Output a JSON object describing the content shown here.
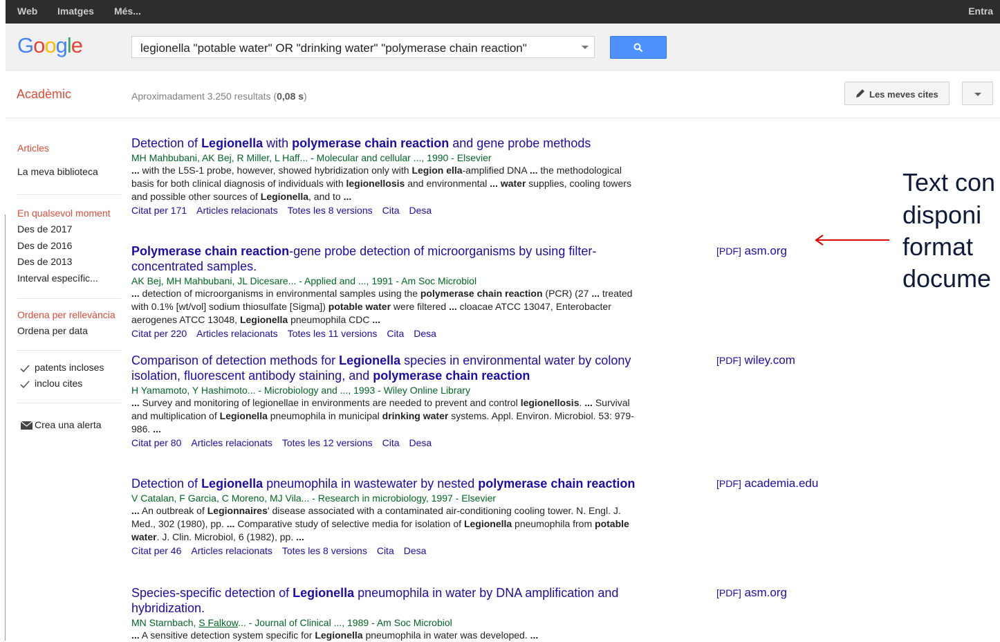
{
  "topbar": {
    "items": [
      "Web",
      "Imatges",
      "Més..."
    ],
    "right": "Entra"
  },
  "search": {
    "query": "legionella \"potable water\" OR \"drinking water\" \"polymerase chain reaction\""
  },
  "subheader": {
    "section": "Acadèmic",
    "count_prefix": "Aproximadament 3.250 resultats (",
    "count_time": "0,08 s",
    "count_suffix": ")",
    "my_cites": "Les meves cites"
  },
  "sidebar": {
    "articles": "Articles",
    "library": "La meva biblioteca",
    "any_time": "En qualsevol moment",
    "since": [
      "Des de 2017",
      "Des de 2016",
      "Des de 2013",
      "Interval específic..."
    ],
    "sort_relevance": "Ordena per rellevància",
    "sort_date": "Ordena per data",
    "patents": "patents incloses",
    "citations": "inclou cites",
    "alert": "Crea una alerta"
  },
  "results": [
    {
      "title_html": "Detection of <b>Legionella</b> with <b>polymerase chain reaction</b> and gene probe methods",
      "authors_html": "MH Mahbubani, AK Bej, R Miller, L Haff... - Molecular and cellular ..., 1990 - Elsevier",
      "snippet_html": "<b>...</b> with the L5S-1 probe, however, showed hybridization only with <b>Legion ella</b>-amplified DNA <b>...</b> the methodological basis for both clinical diagnosis of individuals with <b>legionellosis</b> and environmental <b>...</b> <b>water</b> supplies, cooling towers and possible other sources of <b>Legionella</b>, and to <b>...</b>",
      "links": [
        "Citat per 171",
        "Articles relacionats",
        "Totes les 8 versions",
        "Cita",
        "Desa"
      ],
      "pdf": null
    },
    {
      "title_html": "<b>Polymerase chain reaction</b>-gene probe detection of microorganisms by using filter-concentrated samples.",
      "authors_html": "AK Bej, MH Mahbubani, JL Dicesare... - Applied and ..., 1991 - Am Soc Microbiol",
      "snippet_html": "<b>...</b> detection of microorganisms in environmental samples using the <b>polymerase chain reaction</b> (PCR) (27 <b>...</b> treated with 0.1% [wt/vol] sodium thiosulfate [Sigma]) <b>potable water</b> were filtered <b>...</b> cloacae ATCC 13047, Enterobacter aerogenes ATCC 13048, <b>Legionella</b> pneumophila CDC <b>...</b>",
      "links": [
        "Citat per 220",
        "Articles relacionats",
        "Totes les 11 versions",
        "Cita",
        "Desa"
      ],
      "pdf": {
        "tag": "[PDF]",
        "source": "asm.org"
      }
    },
    {
      "title_html": "Comparison of detection methods for <b>Legionella</b> species in environmental water by colony isolation, fluorescent antibody staining, and <b>polymerase chain reaction</b>",
      "authors_html": "H Yamamoto, Y Hashimoto... - Microbiology and ..., 1993 - Wiley Online Library",
      "snippet_html": "<b>...</b> Survey and monitoring of legionellae in environments are needed to prevent and control <b>legionellosis</b>. <b>...</b> Survival and multiplication of <b>Legionella</b> pneumophila in municipal <b>drinking water</b> systems. Appl. Environ. Microbiol. 53: 979-986. <b>...</b>",
      "links": [
        "Citat per 80",
        "Articles relacionats",
        "Totes les 12 versions",
        "Cita",
        "Desa"
      ],
      "pdf": {
        "tag": "[PDF]",
        "source": "wiley.com"
      }
    },
    {
      "title_html": "Detection of <b>Legionella</b> pneumophila in wastewater by nested <b>polymerase chain reaction</b>",
      "authors_html": "V Catalan, F Garcia, C Moreno, MJ Vila... - Research in microbiology, 1997 - Elsevier",
      "snippet_html": "<b>...</b> An outbreak of <b>Legionnaires</b>' disease associated with a contaminated air-conditioning cooling tower. N. Engl. J. Med., 302 (1980), pp. <b>...</b> Comparative study of selective media for isolation of <b>Legionella</b> pneumophila from <b>potable water</b>. J. Clin. Microbiol, 6 (1982), pp. <b>...</b>",
      "links": [
        "Citat per 46",
        "Articles relacionats",
        "Totes les 8 versions",
        "Cita",
        "Desa"
      ],
      "pdf": {
        "tag": "[PDF]",
        "source": "academia.edu"
      }
    },
    {
      "title_html": "Species-specific detection of <b>Legionella</b> pneumophila in water by DNA amplification and hybridization.",
      "authors_html": "MN Starnbach, <u>S Falkow</u>... - Journal of Clinical ..., 1989 - Am Soc Microbiol",
      "snippet_html": "<b>...</b> A sensitive detection system specific for <b>Legionella</b> pneumophila in water was developed. <b>...</b>",
      "links": [],
      "pdf": {
        "tag": "[PDF]",
        "source": "asm.org"
      }
    }
  ],
  "annotation": [
    "Text con",
    "disponi",
    "format",
    "docume"
  ],
  "colors": {
    "accent_red": "#dd4b39",
    "link_blue": "#1a0dab",
    "author_green": "#006621",
    "button_blue": "#4d90fe",
    "annotation_arrow": "#e00000"
  }
}
